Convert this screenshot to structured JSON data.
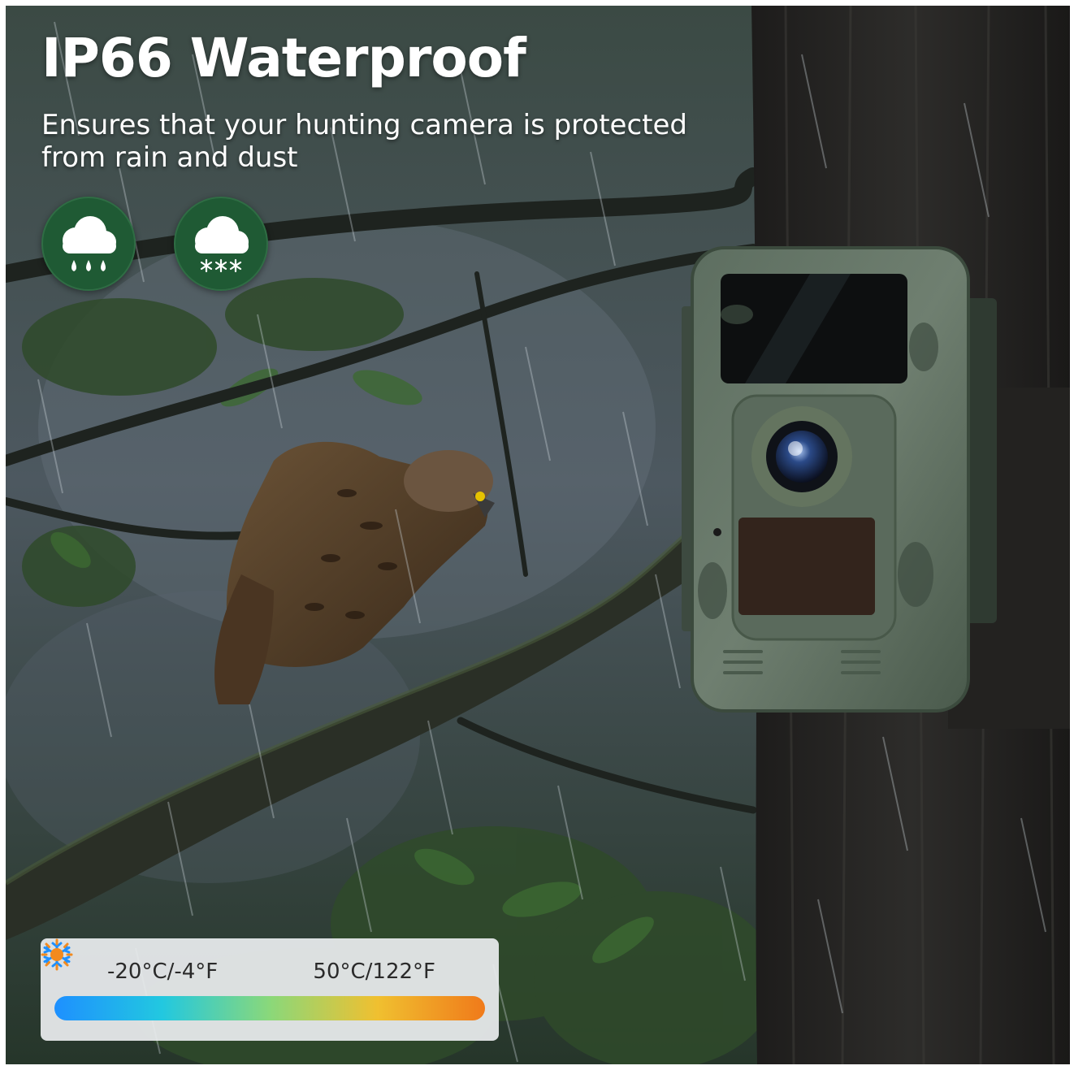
{
  "headline": "IP66 Waterproof",
  "subline": "Ensures that your hunting camera is protected from rain and dust",
  "badges": [
    {
      "icon": "rain-cloud-icon"
    },
    {
      "icon": "snow-cloud-icon"
    }
  ],
  "temperature": {
    "low_label": "-20°C/-4°F",
    "high_label": "50°C/122°F",
    "low_icon": "snowflake-icon",
    "high_icon": "sun-icon",
    "gradient_colors": [
      "#1e90ff",
      "#22c8e0",
      "#8ad87a",
      "#f0c030",
      "#f07a1a"
    ]
  },
  "colors": {
    "badge_green": "#1f5a34",
    "cold_blue": "#1e90ff",
    "sun_orange": "#f28a1e"
  }
}
